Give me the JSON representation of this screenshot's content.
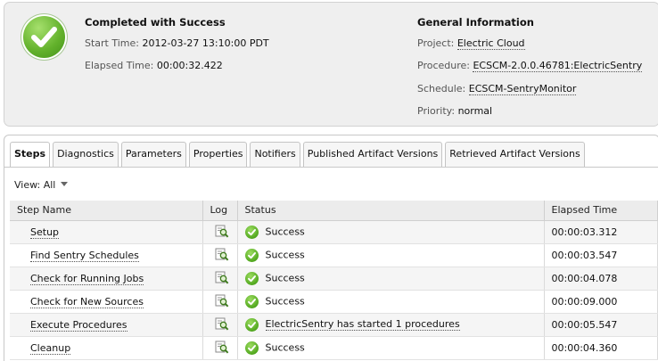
{
  "summary": {
    "status_title": "Completed with Success",
    "start_label": "Start Time:",
    "start_value": "2012-03-27 13:10:00 PDT",
    "elapsed_label": "Elapsed Time:",
    "elapsed_value": "00:00:32.422",
    "status_color": "#5aab24"
  },
  "general": {
    "title": "General Information",
    "project_label": "Project:",
    "project_value": "Electric Cloud",
    "procedure_label": "Procedure:",
    "procedure_value": "ECSCM-2.0.0.46781:ElectricSentry",
    "schedule_label": "Schedule:",
    "schedule_value": "ECSCM-SentryMonitor",
    "priority_label": "Priority:",
    "priority_value": "normal"
  },
  "tabs": [
    "Steps",
    "Diagnostics",
    "Parameters",
    "Properties",
    "Notifiers",
    "Published Artifact Versions",
    "Retrieved Artifact Versions"
  ],
  "active_tab": "Steps",
  "view": {
    "label": "View:",
    "value": "All"
  },
  "table": {
    "columns": [
      "Step Name",
      "Log",
      "Status",
      "Elapsed Time"
    ],
    "rows": [
      {
        "name": "Setup",
        "status": "Success",
        "elapsed": "00:00:03.312"
      },
      {
        "name": "Find Sentry Schedules",
        "status": "Success",
        "elapsed": "00:00:03.547"
      },
      {
        "name": "Check for Running Jobs",
        "status": "Success",
        "elapsed": "00:00:04.078"
      },
      {
        "name": "Check for New Sources",
        "status": "Success",
        "elapsed": "00:00:09.000"
      },
      {
        "name": "Execute Procedures",
        "status": "ElectricSentry has started 1 procedures",
        "elapsed": "00:00:05.547"
      },
      {
        "name": "Cleanup",
        "status": "Success",
        "elapsed": "00:00:04.360"
      }
    ]
  },
  "icons": {
    "status": "check-circle-icon",
    "log": "magnifier-log-icon",
    "row_status": "success-check-icon",
    "view_dropdown": "caret-down-icon"
  }
}
